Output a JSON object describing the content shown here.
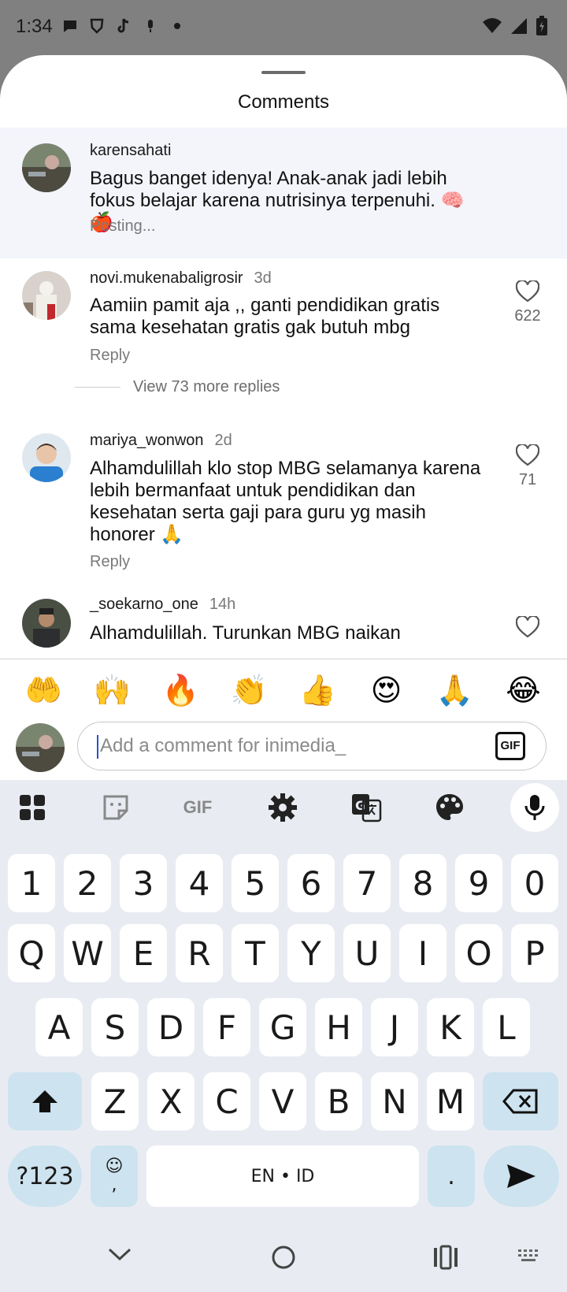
{
  "status": {
    "time": "1:34"
  },
  "sheet": {
    "title": "Comments"
  },
  "comments": [
    {
      "user": "karensahati",
      "time": "",
      "text": "Bagus banget idenya! Anak-anak jadi lebih fokus belajar karena nutrisinya terpenuhi. 🧠🍎",
      "action": "Posting...",
      "likes": ""
    },
    {
      "user": "novi.mukenabaligrosir",
      "time": "3d",
      "text": "Aamiin pamit aja ,, ganti pendidikan gratis sama kesehatan gratis gak butuh mbg",
      "action": "Reply",
      "likes": "622",
      "view_replies": "View 73 more replies"
    },
    {
      "user": "mariya_wonwon",
      "time": "2d",
      "text": "Alhamdulillah klo stop MBG selamanya karena lebih bermanfaat untuk pendidikan dan kesehatan serta gaji para guru yg masih honorer 🙏",
      "action": "Reply",
      "likes": "71"
    },
    {
      "user": "_soekarno_one",
      "time": "14h",
      "text": "Alhamdulillah. Turunkan MBG naikan",
      "action": "",
      "likes": ""
    }
  ],
  "emojis": [
    "🤲",
    "🙌",
    "🔥",
    "👏",
    "👍",
    "😍",
    "🙏",
    "😂"
  ],
  "composer": {
    "placeholder": "Add a comment for inimedia_",
    "gif_label": "GIF"
  },
  "keyboard": {
    "toolbar": {
      "gif_label": "GIF"
    },
    "row_numbers": [
      "1",
      "2",
      "3",
      "4",
      "5",
      "6",
      "7",
      "8",
      "9",
      "0"
    ],
    "row_top": [
      "Q",
      "W",
      "E",
      "R",
      "T",
      "Y",
      "U",
      "I",
      "O",
      "P"
    ],
    "row_mid": [
      "A",
      "S",
      "D",
      "F",
      "G",
      "H",
      "J",
      "K",
      "L"
    ],
    "row_bottom": [
      "Z",
      "X",
      "C",
      "V",
      "B",
      "N",
      "M"
    ],
    "symbols_label": "?123",
    "emoji_comma_top": "☺",
    "emoji_comma_bottom": ",",
    "space_label": "EN • ID",
    "period_label": "."
  },
  "colors": {
    "sheet_bg": "#ffffff",
    "pending_bg": "#f3f5fb",
    "keyboard_bg": "#e8ecf2",
    "mod_key_bg": "#cde3ef"
  }
}
